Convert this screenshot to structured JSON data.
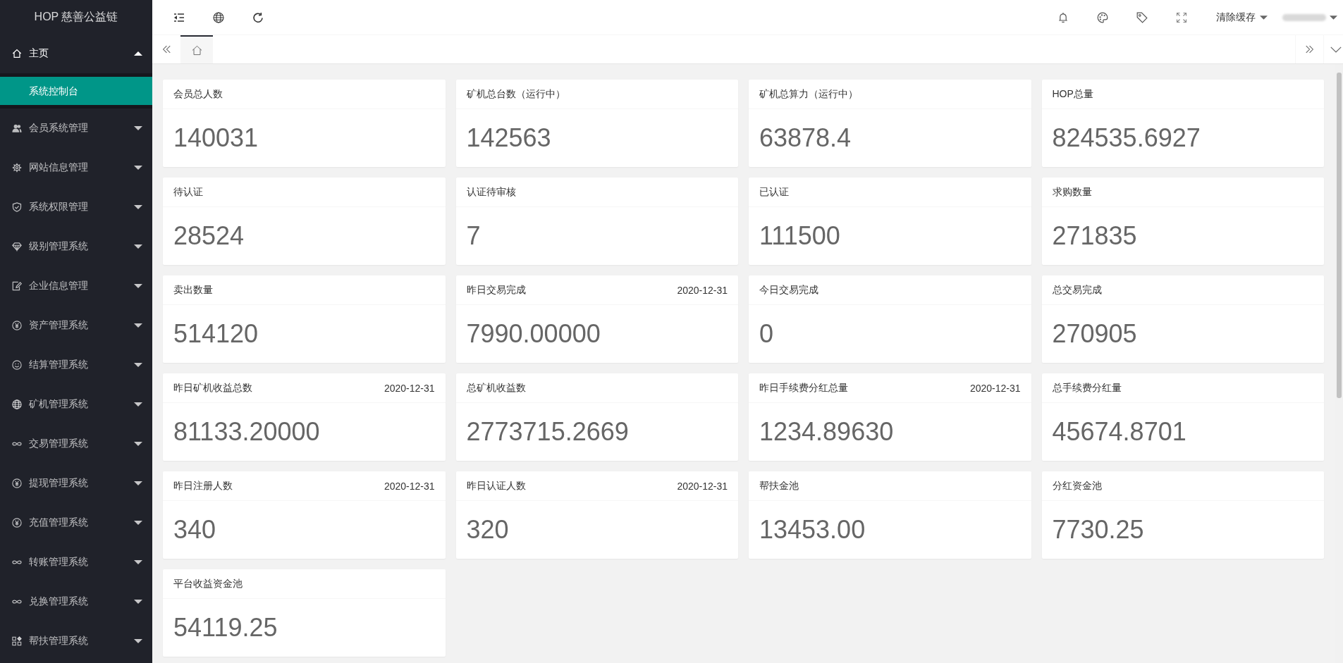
{
  "sidebar": {
    "logo": "HOP 慈善公益链",
    "items": [
      {
        "label": "主页",
        "expanded": true,
        "children": [
          {
            "label": "系统控制台",
            "selected": true
          }
        ]
      },
      {
        "label": "会员系统管理",
        "expanded": false
      },
      {
        "label": "网站信息管理",
        "expanded": false
      },
      {
        "label": "系统权限管理",
        "expanded": false
      },
      {
        "label": "级别管理系统",
        "expanded": false
      },
      {
        "label": "企业信息管理",
        "expanded": false
      },
      {
        "label": "资产管理系统",
        "expanded": false
      },
      {
        "label": "结算管理系统",
        "expanded": false
      },
      {
        "label": "矿机管理系统",
        "expanded": false
      },
      {
        "label": "交易管理系统",
        "expanded": false
      },
      {
        "label": "提现管理系统",
        "expanded": false
      },
      {
        "label": "充值管理系统",
        "expanded": false
      },
      {
        "label": "转账管理系统",
        "expanded": false
      },
      {
        "label": "兑换管理系统",
        "expanded": false
      },
      {
        "label": "帮扶管理系统",
        "expanded": false
      }
    ]
  },
  "header": {
    "clear_cache": "清除缓存"
  },
  "page_tabs": [
    {
      "selected": true
    }
  ],
  "stats": [
    {
      "title": "会员总人数",
      "value": "140031"
    },
    {
      "title": "矿机总台数（运行中）",
      "value": "142563"
    },
    {
      "title": "矿机总算力（运行中）",
      "value": "63878.4"
    },
    {
      "title": "HOP总量",
      "value": "824535.6927"
    },
    {
      "title": "待认证",
      "value": "28524"
    },
    {
      "title": "认证待审核",
      "value": "7"
    },
    {
      "title": "已认证",
      "value": "111500"
    },
    {
      "title": "求购数量",
      "value": "271835"
    },
    {
      "title": "卖出数量",
      "value": "514120"
    },
    {
      "title": "昨日交易完成",
      "date": "2020-12-31",
      "value": "7990.00000"
    },
    {
      "title": "今日交易完成",
      "value": "0"
    },
    {
      "title": "总交易完成",
      "value": "270905"
    },
    {
      "title": "昨日矿机收益总数",
      "date": "2020-12-31",
      "value": "81133.20000"
    },
    {
      "title": "总矿机收益数",
      "value": "2773715.2669"
    },
    {
      "title": "昨日手续费分红总量",
      "date": "2020-12-31",
      "value": "1234.89630"
    },
    {
      "title": "总手续费分红量",
      "value": "45674.8701"
    },
    {
      "title": "昨日注册人数",
      "date": "2020-12-31",
      "value": "340"
    },
    {
      "title": "昨日认证人数",
      "date": "2020-12-31",
      "value": "320"
    },
    {
      "title": "帮扶金池",
      "value": "13453.00"
    },
    {
      "title": "分红资金池",
      "value": "7730.25"
    },
    {
      "title": "平台收益资金池",
      "value": "54119.25"
    }
  ]
}
